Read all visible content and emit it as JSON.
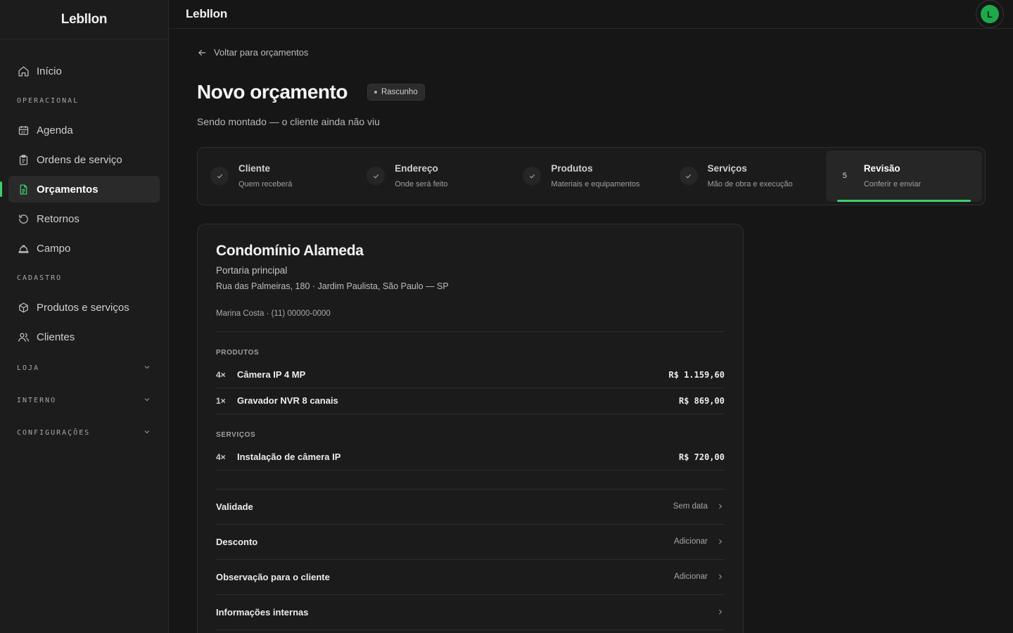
{
  "app": {
    "brand": "Lebllon",
    "header_title": "Lebllon",
    "avatar_initial": "L",
    "accent": "#3ecf6a",
    "avatar_color": "#1fa84a"
  },
  "sidebar": {
    "home": {
      "label": "Início",
      "icon": "home-icon"
    },
    "sections": {
      "operacional": "OPERACIONAL",
      "cadastro": "CADASTRO",
      "loja": "LOJA",
      "interno": "INTERNO",
      "configuracoes": "CONFIGURAÇÕES"
    },
    "operacional_items": [
      {
        "label": "Agenda",
        "icon": "calendar-icon"
      },
      {
        "label": "Ordens de serviço",
        "icon": "clipboard-icon"
      },
      {
        "label": "Orçamentos",
        "icon": "document-icon",
        "active": true
      },
      {
        "label": "Retornos",
        "icon": "rotate-icon"
      },
      {
        "label": "Campo",
        "icon": "hardhat-icon"
      }
    ],
    "cadastro_items": [
      {
        "label": "Produtos e serviços",
        "icon": "box-icon"
      },
      {
        "label": "Clientes",
        "icon": "users-icon"
      }
    ]
  },
  "page": {
    "back_label": "Voltar para orçamentos",
    "title": "Novo orçamento",
    "badge": "Rascunho",
    "subtitle": "Sendo montado — o cliente ainda não viu"
  },
  "stepper": [
    {
      "title": "Cliente",
      "sub": "Quem receberá",
      "status": "done"
    },
    {
      "title": "Endereço",
      "sub": "Onde será feito",
      "status": "done"
    },
    {
      "title": "Produtos",
      "sub": "Materiais e equipamentos",
      "status": "done"
    },
    {
      "title": "Serviços",
      "sub": "Mão de obra e execução",
      "status": "done"
    },
    {
      "title": "Revisão",
      "sub": "Conferir e enviar",
      "status": "active",
      "number": "5"
    }
  ],
  "summary": {
    "client_name": "Condomínio Alameda",
    "location": "Portaria principal",
    "address": "Rua das Palmeiras, 180 · Jardim Paulista, São Paulo — SP",
    "contact": "Marina Costa · (11) 00000-0000",
    "products_label": "PRODUTOS",
    "products": [
      {
        "qty": "4×",
        "name": "Câmera IP 4 MP",
        "price": "R$ 1.159,60"
      },
      {
        "qty": "1×",
        "name": "Gravador NVR 8 canais",
        "price": "R$ 869,00"
      }
    ],
    "services_label": "SERVIÇOS",
    "services": [
      {
        "qty": "4×",
        "name": "Instalação de câmera IP",
        "price": "R$ 720,00"
      }
    ],
    "options": [
      {
        "label": "Validade",
        "value": "Sem data"
      },
      {
        "label": "Desconto",
        "value": "Adicionar"
      },
      {
        "label": "Observação para o cliente",
        "value": "Adicionar"
      },
      {
        "label": "Informações internas",
        "value": ""
      }
    ]
  }
}
